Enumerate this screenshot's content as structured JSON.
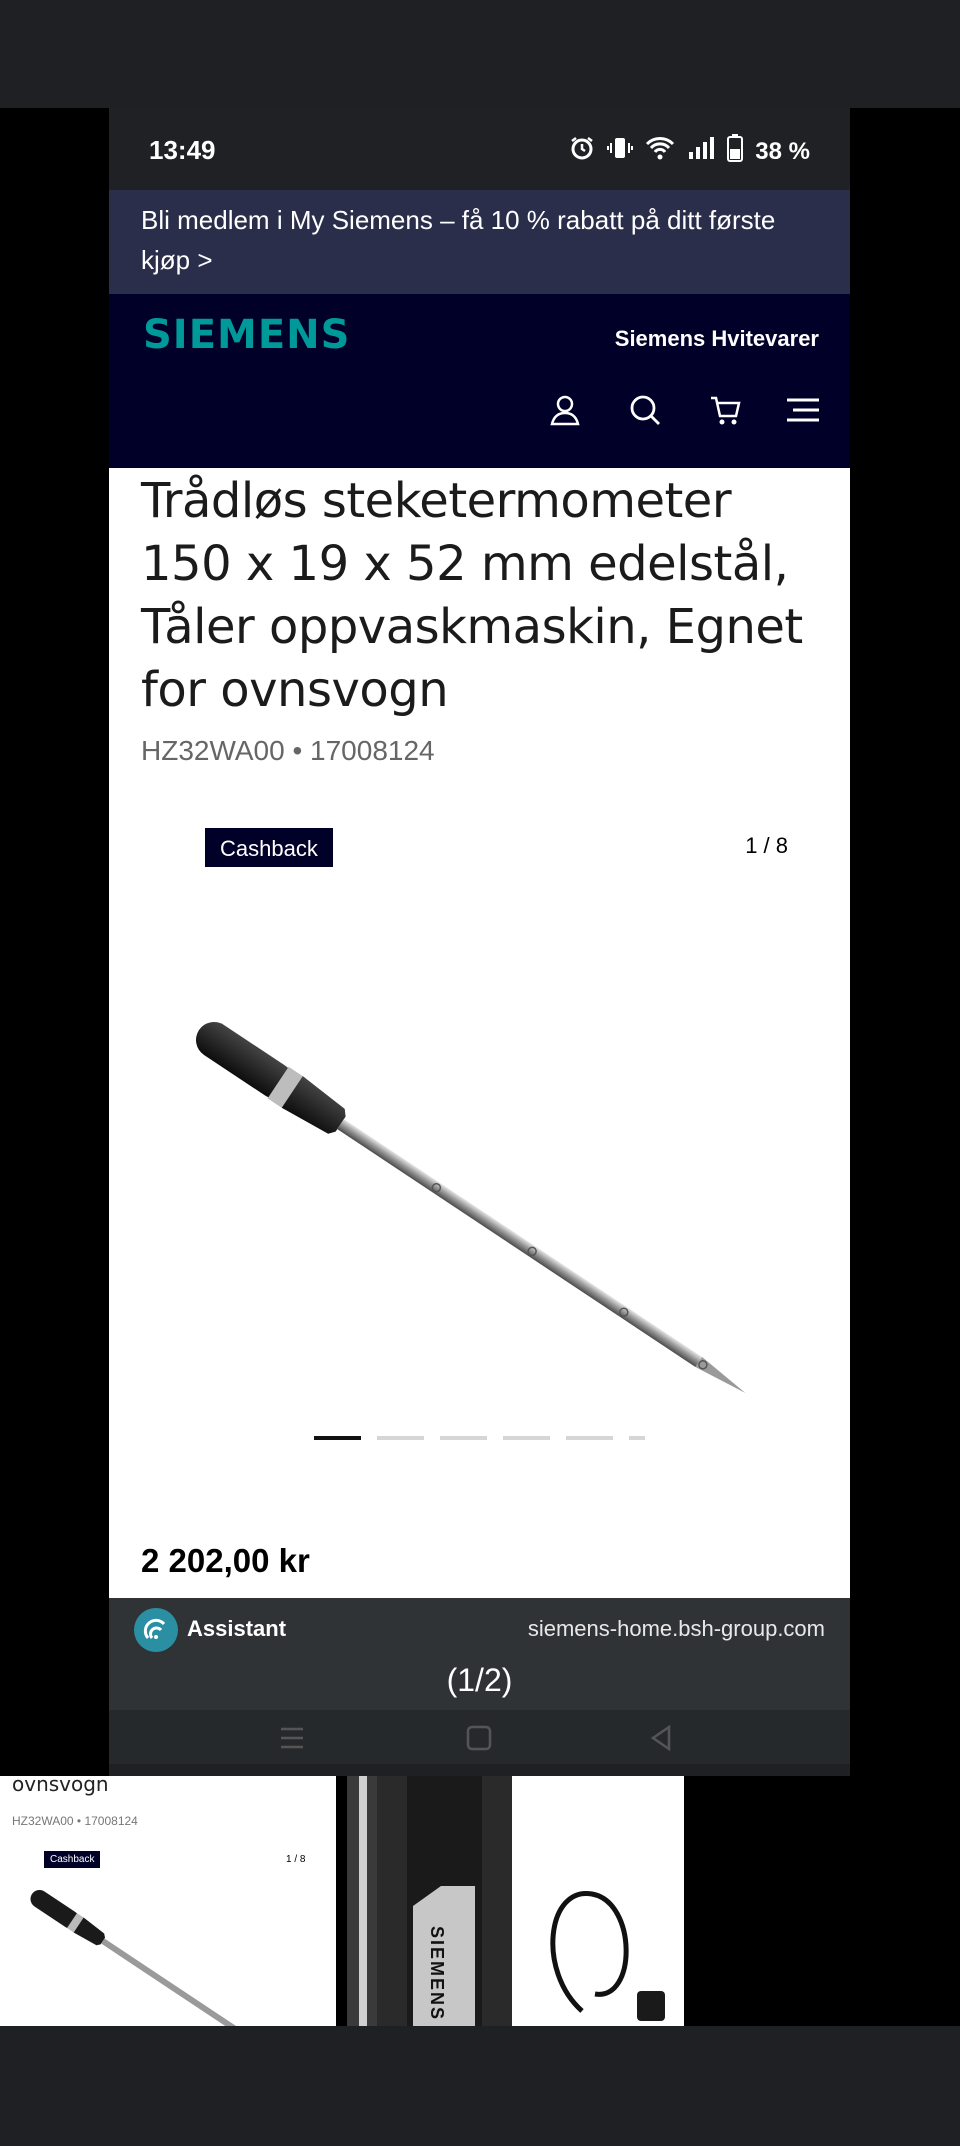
{
  "status": {
    "time": "13:49",
    "battery": "38 %"
  },
  "promo": {
    "text": "Bli medlem i My Siemens – få 10 % rabatt på ditt første kjøp >"
  },
  "header": {
    "logo": "SIEMENS",
    "brand": "Siemens Hvitevarer"
  },
  "product": {
    "title": "Trådløs steketermometer 150 x 19 x 52 mm edelstål, Tåler oppvaskmaskin, Egnet for ovnsvogn",
    "sku": "HZ32WA00 • 17008124",
    "badge": "Cashback",
    "counter": "1 / 8",
    "price": "2 202,00 kr"
  },
  "assistant": {
    "label": "Assistant",
    "url": "siemens-home.bsh-group.com",
    "pager": "(1/2)"
  },
  "thumbs": {
    "t1_title": "ovnsvogn",
    "t1_sku": "HZ32WA00 • 17008124",
    "t1_badge": "Cashback",
    "t1_counter": "1 / 8",
    "t2_brand": "SIEMENS"
  },
  "colors": {
    "navy": "#000028",
    "teal": "#009999",
    "promo_bg": "#2a2e4a"
  },
  "icons": [
    "alarm-icon",
    "vibrate-icon",
    "wifi-icon",
    "signal-icon",
    "battery-icon",
    "account-icon",
    "search-icon",
    "cart-icon",
    "menu-icon"
  ]
}
